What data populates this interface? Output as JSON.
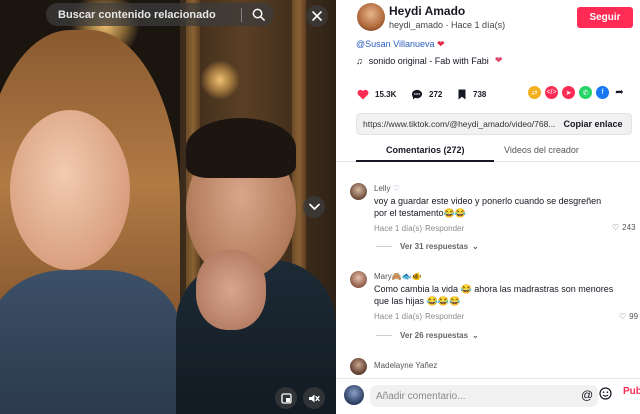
{
  "video": {
    "search_placeholder": "Buscar contenido relacionado"
  },
  "author": {
    "name": "Heydi Amado",
    "meta": "heydi_amado · Hace 1 día(s)",
    "follow_label": "Seguir",
    "mention": "@Susan Villanueva",
    "music": "sonido original - Fab with Fabi"
  },
  "stats": {
    "likes": "15.3K",
    "comments": "272",
    "saves": "738"
  },
  "link": {
    "url": "https://www.tiktok.com/@heydi_amado/video/768...",
    "copy_label": "Copiar enlace"
  },
  "tabs": {
    "comments": "Comentarios (272)",
    "creator_videos": "Videos del creador"
  },
  "comments": [
    {
      "user": "Lelly",
      "line1": "voy a guardar este video y ponerlo cuando se desgreñen",
      "line2": "por el testamento😂😂",
      "time": "Hace 1 día(s)",
      "reply": "Responder",
      "likes": "243",
      "more": "Ver 31 respuestas"
    },
    {
      "user": "Mary🙈🐟🐠",
      "line1": "Como cambia la vida 😂 ahora las madrastras son menores",
      "line2": "que las hijas 😂😂😂",
      "time": "Hace 1 día(s)",
      "reply": "Responder",
      "likes": "99",
      "more": "Ver 26 respuestas"
    },
    {
      "user": "Madelayne Yañez"
    }
  ],
  "composer": {
    "placeholder": "Añadir comentario...",
    "mention_icon": "@",
    "send_label": "Publicar"
  },
  "colors": {
    "accent": "#fe2c55",
    "mention": "#2b5db9"
  }
}
